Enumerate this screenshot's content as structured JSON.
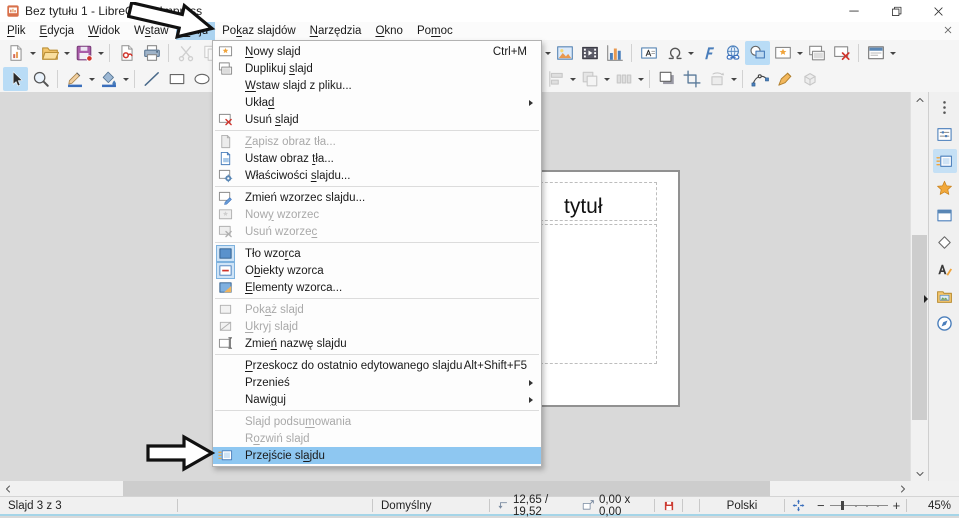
{
  "window": {
    "title": "Bez tytułu 1 - LibreOffice Impress",
    "controls": [
      {
        "name": "minimize-button",
        "icon": "win-min"
      },
      {
        "name": "restore-button",
        "icon": "win-restore"
      },
      {
        "name": "close-button",
        "icon": "win-close"
      }
    ]
  },
  "menubar": {
    "items": [
      {
        "name": "menu-plik",
        "label": "Plik",
        "u": 0
      },
      {
        "name": "menu-edycja",
        "label": "Edycja",
        "u": 0
      },
      {
        "name": "menu-widok",
        "label": "Widok",
        "u": 0
      },
      {
        "name": "menu-wstaw",
        "label": "Wstaw",
        "u": 1
      },
      {
        "name": "menu-slajd",
        "label": "Slajd",
        "u": 0,
        "active": true
      },
      {
        "name": "menu-pokaz-slajdow",
        "label": "Pokaz slajdów",
        "u": 2
      },
      {
        "name": "menu-narzedzia",
        "label": "Narzędzia",
        "u": 0
      },
      {
        "name": "menu-okno",
        "label": "Okno",
        "u": 0
      },
      {
        "name": "menu-pomoc",
        "label": "Pomoc",
        "u": 2
      }
    ]
  },
  "slide_menu": {
    "items": [
      {
        "name": "new-slide",
        "label": "Nowy slajd",
        "u": 0,
        "accel": "Ctrl+M",
        "icon": "slide-new"
      },
      {
        "name": "duplicate-slide",
        "label": "Duplikuj slajd",
        "u": 9,
        "icon": "slide-dup"
      },
      {
        "name": "insert-slide-from-file",
        "label": "Wstaw slajd z pliku...",
        "u": 0
      },
      {
        "name": "layout",
        "label": "Układ",
        "u": 4,
        "submenu": true
      },
      {
        "name": "delete-slide",
        "label": "Usuń slajd",
        "u": 5,
        "icon": "slide-del"
      },
      {
        "sep": true
      },
      {
        "name": "save-background-image",
        "label": "Zapisz obraz tła...",
        "u": 0,
        "icon": "save-bg",
        "disabled": true
      },
      {
        "name": "set-background-image",
        "label": "Ustaw obraz tła...",
        "u": 12,
        "icon": "set-bg"
      },
      {
        "name": "slide-properties",
        "label": "Właściwości slajdu...",
        "u": 12,
        "icon": "slide-props"
      },
      {
        "sep": true
      },
      {
        "name": "change-slide-master",
        "label": "Zmień wzorzec slajdu...",
        "u": 17,
        "icon": "change-master"
      },
      {
        "name": "new-master",
        "label": "Nowy wzorzec",
        "u": 3,
        "icon": "new-master",
        "disabled": true
      },
      {
        "name": "delete-master",
        "label": "Usuń wzorzec",
        "u": 11,
        "icon": "delete-master",
        "disabled": true
      },
      {
        "sep": true
      },
      {
        "name": "master-background",
        "label": "Tło wzorca",
        "u": 7,
        "icon": "master-bg",
        "checked": true
      },
      {
        "name": "master-objects",
        "label": "Obiekty wzorca",
        "u": 1,
        "icon": "master-objects",
        "checked": true
      },
      {
        "name": "master-elements",
        "label": "Elementy wzorca...",
        "u": 0,
        "icon": "master-elements"
      },
      {
        "sep": true
      },
      {
        "name": "show-slide",
        "label": "Pokaż slajd",
        "u": 3,
        "icon": "show-slide",
        "disabled": true
      },
      {
        "name": "hide-slide",
        "label": "Ukryj slajd",
        "u": 0,
        "icon": "hide-slide",
        "disabled": true
      },
      {
        "name": "rename-slide",
        "label": "Zmień nazwę slajdu",
        "u": 4,
        "icon": "rename-slide"
      },
      {
        "sep": true
      },
      {
        "name": "jump-to-last-edited-slide",
        "label": "Przeskocz do ostatnio edytowanego slajdu",
        "u": 0,
        "accel": "Alt+Shift+F5"
      },
      {
        "name": "move-slide",
        "label": "Przenieś",
        "submenu": true
      },
      {
        "name": "navigate",
        "label": "Nawiguj",
        "u": 4,
        "submenu": true
      },
      {
        "sep": true
      },
      {
        "name": "summary-slide",
        "label": "Slajd podsumowania",
        "u": 11,
        "disabled": true
      },
      {
        "name": "expand-slide",
        "label": "Rozwiń slajd",
        "u": 1,
        "disabled": true
      },
      {
        "name": "slide-transition",
        "label": "Przejście slajdu",
        "u": 12,
        "icon": "transition",
        "highlighted": true
      }
    ]
  },
  "toolbars": {
    "row1_left": [
      {
        "name": "new-document",
        "icon": "doc-new",
        "dd": true
      },
      {
        "name": "open",
        "icon": "open",
        "dd": true
      },
      {
        "name": "save",
        "icon": "save",
        "dd": true
      },
      {
        "sep": true
      },
      {
        "name": "export-pdf",
        "icon": "export-pdf"
      },
      {
        "name": "print",
        "icon": "print"
      },
      {
        "sep": true
      },
      {
        "name": "cut",
        "icon": "cut",
        "disabled": true
      },
      {
        "name": "copy",
        "icon": "copy",
        "disabled": true
      }
    ],
    "row1_right": [
      {
        "name": "insert-table-dropdown",
        "dd": true,
        "icononly_dd": true
      },
      {
        "name": "insert-image",
        "icon": "image"
      },
      {
        "name": "insert-media",
        "icon": "media"
      },
      {
        "name": "insert-chart",
        "icon": "chart"
      },
      {
        "sep": true
      },
      {
        "name": "insert-textbox",
        "icon": "textbox"
      },
      {
        "name": "special-character",
        "icon": "omega",
        "dd": true
      },
      {
        "name": "fontwork",
        "icon": "fontwork"
      },
      {
        "name": "hyperlink",
        "icon": "hyperlink"
      },
      {
        "name": "show-draw-functions",
        "icon": "shapes",
        "active": true
      },
      {
        "name": "new-slide-button",
        "icon": "slide-new",
        "dd": true
      },
      {
        "name": "duplicate-slide-button",
        "icon": "slide-dup"
      },
      {
        "name": "delete-slide-button",
        "icon": "slide-del"
      },
      {
        "sep": true
      },
      {
        "name": "master-slide-button",
        "icon": "master-slide",
        "dd": true
      }
    ],
    "row2_left": [
      {
        "name": "select-tool",
        "icon": "select",
        "active": true
      },
      {
        "name": "zoom-tool",
        "icon": "zoom-ico"
      },
      {
        "sep": true
      },
      {
        "name": "line-color",
        "icon": "line-color",
        "dd": true
      },
      {
        "name": "fill-color",
        "icon": "fill-color",
        "dd": true
      },
      {
        "sep": true
      },
      {
        "name": "insert-line",
        "icon": "line-ico"
      },
      {
        "name": "rectangle-tool",
        "icon": "rect-ico"
      },
      {
        "name": "ellipse-tool",
        "icon": "ellipse-ico"
      },
      {
        "sep": true
      }
    ],
    "row2_right": [
      {
        "name": "align-objects",
        "icon": "align",
        "dd": true,
        "disabled": true
      },
      {
        "name": "arrange",
        "icon": "arrange",
        "dd": true,
        "disabled": true
      },
      {
        "name": "distribute",
        "icon": "distribute",
        "dd": true,
        "disabled": true
      },
      {
        "sep": true
      },
      {
        "name": "shadow",
        "icon": "shadow"
      },
      {
        "name": "crop",
        "icon": "crop"
      },
      {
        "name": "transformations",
        "icon": "transform",
        "dd": true,
        "disabled": true
      },
      {
        "sep": true
      },
      {
        "name": "edit-points",
        "icon": "points"
      },
      {
        "name": "glue-points",
        "icon": "gluepoint"
      },
      {
        "name": "3d-effects",
        "icon": "threed",
        "disabled": true
      }
    ]
  },
  "slide": {
    "title_text": "tytuł"
  },
  "sidebar": {
    "icons": [
      {
        "name": "sidebar-settings",
        "icon": "sb-menu"
      },
      {
        "name": "properties-panel",
        "icon": "sb-properties"
      },
      {
        "name": "slide-transition-panel",
        "icon": "sb-transition",
        "active": true
      },
      {
        "name": "animation-panel",
        "icon": "sb-animation"
      },
      {
        "name": "master-slides-panel",
        "icon": "sb-master"
      },
      {
        "name": "shapes-panel",
        "icon": "sb-shapes"
      },
      {
        "name": "styles-panel",
        "icon": "sb-styles"
      },
      {
        "name": "gallery-panel",
        "icon": "sb-gallery"
      },
      {
        "name": "navigator-panel",
        "icon": "sb-navigator"
      }
    ]
  },
  "statusbar": {
    "slide_count": "Slajd 3 z 3",
    "template": "Domyślny",
    "position": "12,65 / 19,52",
    "size": "0,00 x 0,00",
    "language": "Polski",
    "zoom_level": "45%"
  },
  "colors": {
    "menu_highlight": "#8ec7f1",
    "menubar_highlight": "#abd3f0",
    "toolbar_active": "#b9dcf6",
    "sidebar_active": "#c5e0f5",
    "accent_blue": "#4a7ebb"
  }
}
